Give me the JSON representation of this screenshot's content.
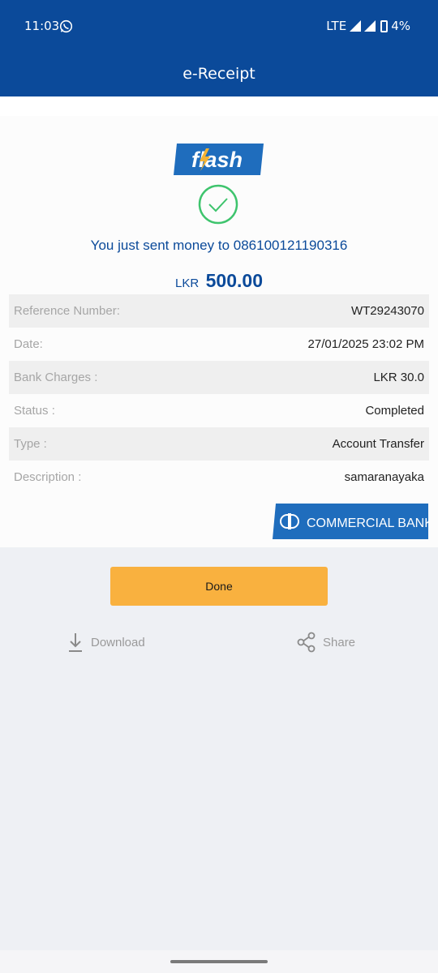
{
  "status_bar": {
    "time": "11:03",
    "network": "LTE",
    "battery": "4%"
  },
  "app_bar": {
    "title": "e-Receipt"
  },
  "logos": {
    "flash_text": "flash",
    "bank_text": "COMMERCIAL BANK"
  },
  "receipt": {
    "message": "You just sent money to 086100121190316",
    "currency": "LKR",
    "amount": "500.00",
    "rows": [
      {
        "label": "Reference Number:",
        "value": "WT29243070"
      },
      {
        "label": "Date:",
        "value": "27/01/2025 23:02 PM"
      },
      {
        "label": "Bank Charges :",
        "value": "LKR 30.0"
      },
      {
        "label": "Status :",
        "value": "Completed"
      },
      {
        "label": "Type :",
        "value": "Account Transfer"
      },
      {
        "label": "Description :",
        "value": "samaranayaka"
      }
    ]
  },
  "actions": {
    "done_label": "Done",
    "download_label": "Download",
    "share_label": "Share"
  },
  "colors": {
    "brand_blue": "#0b4a9a",
    "done_orange": "#f9b13f",
    "success_green": "#3ec46d"
  }
}
